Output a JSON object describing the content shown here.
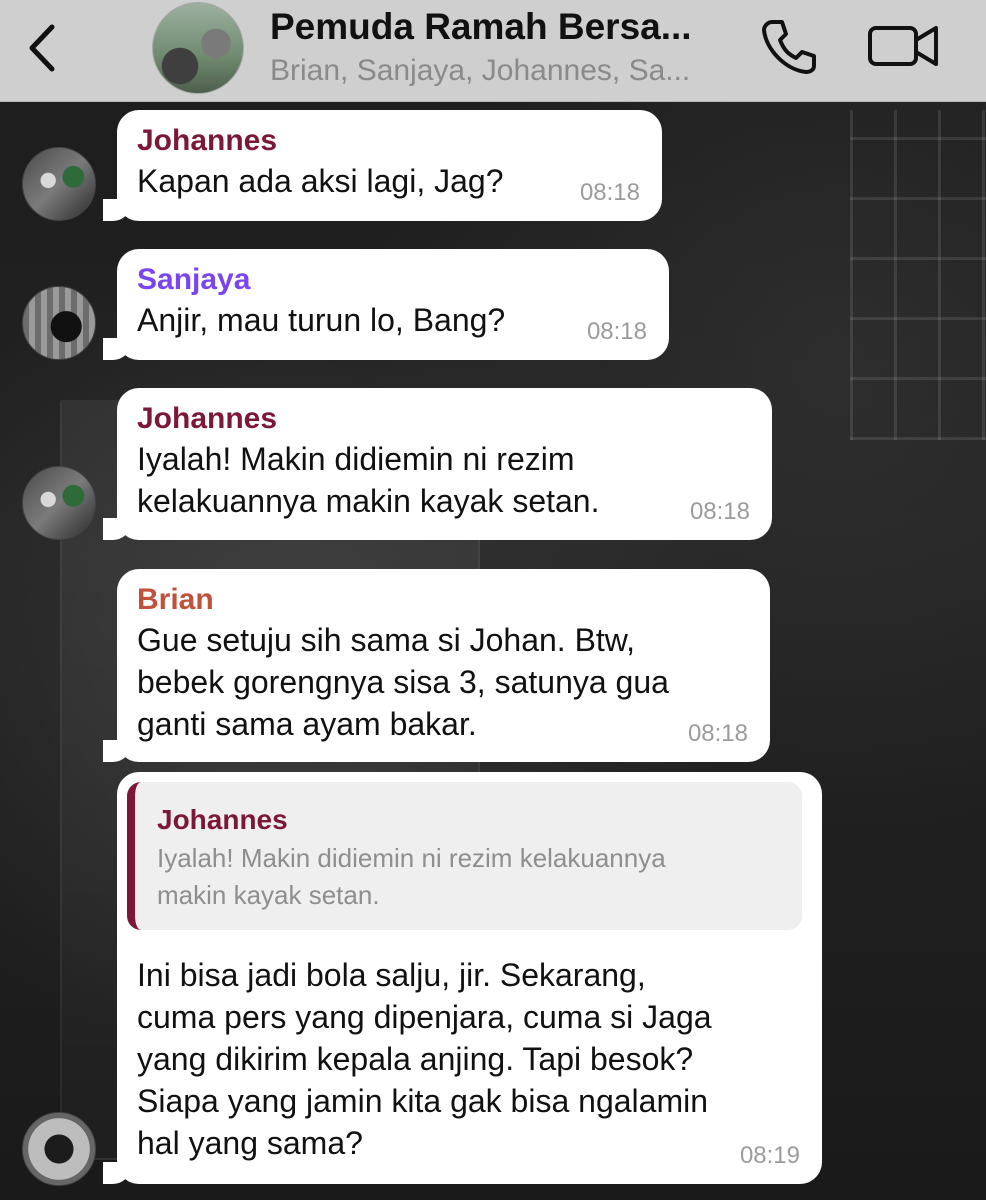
{
  "header": {
    "title": "Pemuda Ramah Bersa...",
    "subtitle": "Brian, Sanjaya, Johannes, Sa..."
  },
  "colors": {
    "johannes": "#7b1837",
    "sanjaya": "#7a44f0",
    "brian": "#c0513a"
  },
  "messages": [
    {
      "sender": "Johannes",
      "lines": [
        "Kapan ada aksi lagi, Jag?"
      ],
      "time": "08:18"
    },
    {
      "sender": "Sanjaya",
      "lines": [
        "Anjir, mau turun lo, Bang?"
      ],
      "time": "08:18"
    },
    {
      "sender": "Johannes",
      "lines": [
        "Iyalah! Makin didiemin ni rezim",
        "kelakuannya makin kayak setan."
      ],
      "time": "08:18"
    },
    {
      "sender": "Brian",
      "lines": [
        "Gue setuju sih sama si Johan. Btw,",
        "bebek gorengnya sisa 3, satunya gua",
        "ganti sama ayam bakar."
      ],
      "time": "08:18"
    },
    {
      "reply_to": {
        "name": "Johannes",
        "lines": [
          "Iyalah! Makin didiemin ni rezim kelakuannya",
          "makin kayak setan."
        ]
      },
      "lines": [
        "Ini bisa jadi bola salju, jir. Sekarang,",
        "cuma pers yang dipenjara, cuma si Jaga",
        "yang dikirim kepala anjing. Tapi besok?",
        "Siapa yang jamin kita gak bisa ngalamin",
        "hal yang sama?"
      ],
      "time": "08:19"
    }
  ]
}
